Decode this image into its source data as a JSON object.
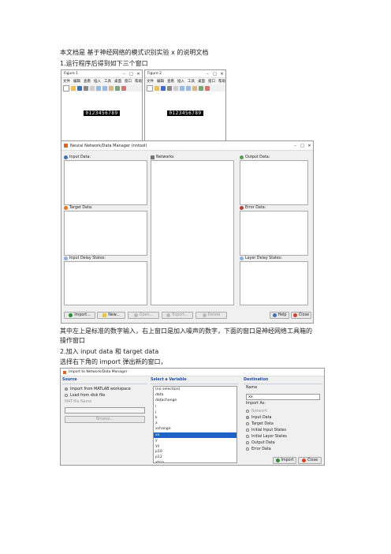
{
  "doc": {
    "line1": "本文档是    基于神经网络的模式识别实验 x  的说明文档",
    "line2": "1.运行程序后得到如下三个窗口",
    "para1a": "其中左上是标准的数字输入，右上窗口是加入噪声的数字，下面的窗口是神经网络工具箱的",
    "para1b": "操作窗口",
    "line3": "2.加入 input data 和 target data",
    "line4": "选择右下角的 import  弹出新的窗口，"
  },
  "fig1": {
    "title": "Figure 1",
    "menu": [
      "文件",
      "编辑",
      "查看",
      "插入",
      "工具",
      "桌面",
      "窗口",
      "帮助"
    ],
    "digits": "0123456789"
  },
  "fig2": {
    "title": "Figure 2",
    "menu": [
      "文件",
      "编辑",
      "查看",
      "插入",
      "工具",
      "桌面",
      "窗口",
      "帮助"
    ],
    "digits": "0123456789"
  },
  "nntool": {
    "title": "Neural Network/Data Manager (nntool)",
    "input_data": "Input Data:",
    "target_data": "Target Data:",
    "input_delay": "Input Delay States:",
    "networks": "Networks",
    "output_data": "Output Data:",
    "error_data": "Error Data:",
    "layer_delay": "Layer Delay States:",
    "buttons": {
      "import": "Import...",
      "new": "New...",
      "open": "Open...",
      "export": "Export...",
      "delete": "Delete",
      "help": "Help",
      "close": "Close"
    }
  },
  "import_dialog": {
    "title": "Import to Network/Data Manager",
    "source_header": "Source",
    "source_opt1": "Import from MATLAB workspace",
    "source_opt2": "Load from disk file",
    "matfile_label": "MAT-file Name",
    "browse": "Browse...",
    "select_header": "Select a Variable",
    "variables": [
      "(no selection)",
      "data",
      "datachange",
      "i",
      "j",
      "k",
      "x",
      "xchange",
      "xx",
      "y",
      "yy",
      "p10",
      "p12",
      "xtrra"
    ],
    "selected_variable": "xx",
    "dest_header": "Destination",
    "name_label": "Name",
    "name_value": "xx",
    "import_as": "Import As:",
    "dest_options": [
      "Network",
      "Input Data",
      "Target Data",
      "Initial Input States",
      "Initial Layer States",
      "Output Data",
      "Error Data"
    ],
    "dest_selected": "Input Data",
    "import_button": "Import",
    "close_button": "Close"
  },
  "colors": {
    "accent": "#1e63c5",
    "import_icon": "#2e8b3a",
    "close_icon": "#d9412b",
    "target_icon": "#e07b22"
  }
}
